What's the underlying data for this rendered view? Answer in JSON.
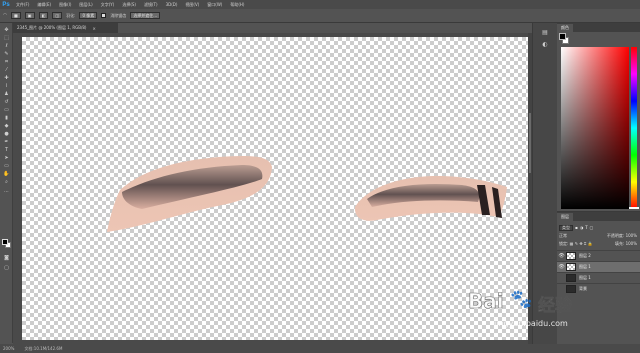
{
  "app": {
    "logo": "Ps"
  },
  "menubar": {
    "items": [
      "文件(F)",
      "编辑(E)",
      "图像(I)",
      "图层(L)",
      "文字(Y)",
      "选择(S)",
      "滤镜(T)",
      "3D(D)",
      "视图(V)",
      "窗口(W)",
      "帮助(H)"
    ]
  },
  "options": {
    "feather_label": "羽化:",
    "feather_value": "0 像素",
    "antialias_label": "消除锯齿",
    "select_mask_label": "选择并遮住..."
  },
  "document": {
    "tab_title": "2345_图片 @ 200% (图层 1, RGB/8)",
    "close": "×"
  },
  "status": {
    "zoom": "200%",
    "doc_size": "文档:10.1M/142.6M"
  },
  "panels": {
    "color_tab": "颜色",
    "layers_tab": "图层",
    "filter_kind": "类型",
    "blend_mode": "正常",
    "opacity_label": "不透明度:",
    "opacity_value": "100%",
    "lock_label": "锁定:",
    "fill_label": "填充:",
    "fill_value": "100%",
    "layers": [
      {
        "name": "图层 2",
        "visible": true,
        "selected": false,
        "thumb": "transparent"
      },
      {
        "name": "图层 1",
        "visible": true,
        "selected": true,
        "thumb": "transparent"
      },
      {
        "name": "图层 1",
        "visible": false,
        "selected": false,
        "thumb": "photo"
      },
      {
        "name": "背景",
        "visible": false,
        "selected": false,
        "thumb": "photo"
      }
    ]
  },
  "watermark": {
    "brand": "Bai",
    "paw": "🐾",
    "brand2": "经验",
    "url": "jingyan.baidu.com"
  },
  "colors": {
    "accent_blue": "#31a8ff",
    "skin": "#e8c0ad",
    "brow": "#4a4040"
  }
}
